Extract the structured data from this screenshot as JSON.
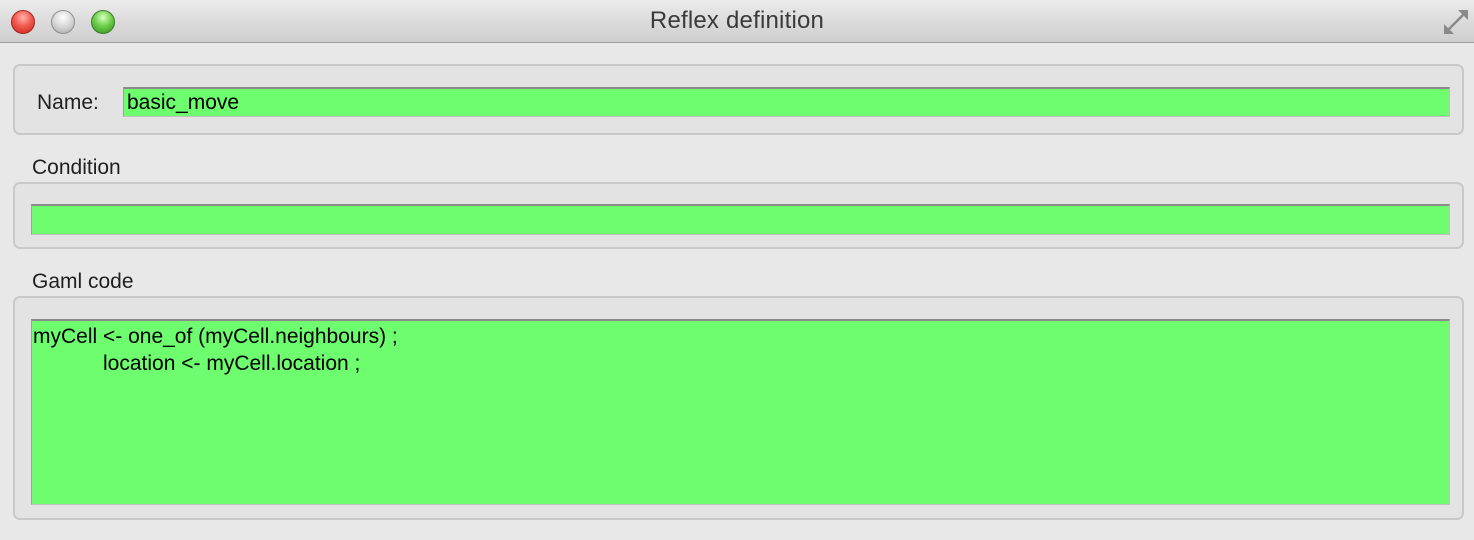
{
  "window": {
    "title": "Reflex definition"
  },
  "titlebar": {
    "buttons": [
      "close-button",
      "minimize-button",
      "zoom-button"
    ],
    "fullscreen_icon": "fullscreen-arrows-icon"
  },
  "colors": {
    "field_background": "#6dfd6f",
    "window_background": "#e8e8e8"
  },
  "name_section": {
    "label": "Name:",
    "value": "basic_move"
  },
  "condition_section": {
    "label": "Condition",
    "value": ""
  },
  "code_section": {
    "label": "Gaml code",
    "lines": [
      "myCell <- one_of (myCell.neighbours) ;",
      "            location <- myCell.location ;"
    ]
  }
}
